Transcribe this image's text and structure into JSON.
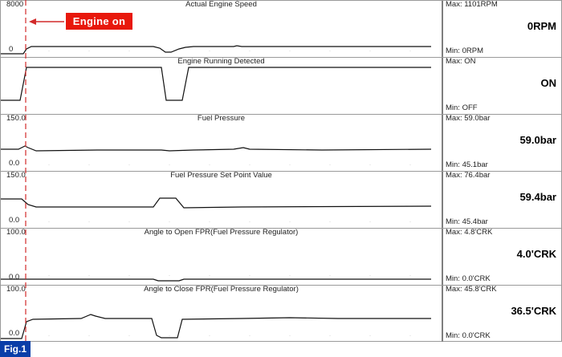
{
  "annotations": {
    "engine_on_label": "Engine on",
    "figure_label": "Fig.1",
    "marker_color": "#d22a2a",
    "label_color": "#e8180c",
    "figure_label_color": "#0a3ea8"
  },
  "panels": [
    {
      "title": "Actual Engine Speed",
      "y_top": "8000",
      "y_bottom": "0",
      "max": "Max:  1101RPM",
      "min": "Min:    0RPM",
      "value": "0RPM"
    },
    {
      "title": "Engine Running Detected",
      "y_top": "",
      "y_bottom": "",
      "max": "Max: ON",
      "min": "Min:  OFF",
      "value": "ON"
    },
    {
      "title": "Fuel Pressure",
      "y_top": "150.0",
      "y_bottom": "0.0",
      "max": "Max:  59.0bar",
      "min": "Min:  45.1bar",
      "value": "59.0bar"
    },
    {
      "title": "Fuel Pressure Set Point Value",
      "y_top": "150.0",
      "y_bottom": "0.0",
      "max": "Max:  76.4bar",
      "min": "Min:  45.4bar",
      "value": "59.4bar"
    },
    {
      "title": "Angle to Open FPR(Fuel Pressure Regulator)",
      "y_top": "100.0",
      "y_bottom": "0.0",
      "max": "Max:   4.8'CRK",
      "min": "Min:    0.0'CRK",
      "value": "4.0'CRK"
    },
    {
      "title": "Angle to Close FPR(Fuel Pressure Regulator)",
      "y_top": "100.0",
      "y_bottom": "0.0",
      "max": "Max:  45.8'CRK",
      "min": "Min:    0.0'CRK",
      "value": "36.5'CRK"
    }
  ]
}
